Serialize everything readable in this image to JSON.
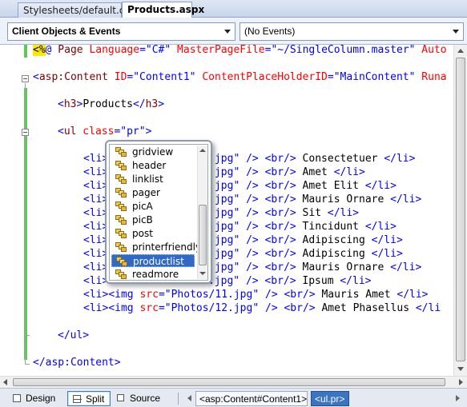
{
  "tabs": {
    "default_css": "Stylesheets/default.css",
    "products_aspx": "Products.aspx"
  },
  "dropdowns": {
    "objects": "Client Objects & Events",
    "events": "(No Events)"
  },
  "code": {
    "l1": {
      "a": "<%",
      "b": "@",
      "c": " Page ",
      "d": "Language",
      "e": "=",
      "f": "\"C#\"",
      "g": " MasterPageFile",
      "h": "=",
      "i": "\"~/SingleColumn.master\"",
      "j": " Auto"
    },
    "l3": {
      "a": "<",
      "b": "asp:Content",
      "c": " ID",
      "d": "=",
      "e": "\"Content1\"",
      "f": " ContentPlaceHolderID",
      "g": "=",
      "h": "\"MainContent\"",
      "i": " Runa"
    },
    "l5": {
      "a": "<",
      "b": "h3",
      "c": ">",
      "d": "Products",
      "e": "</",
      "f": "h3",
      "g": ">"
    },
    "l7": {
      "a": "<",
      "b": "ul",
      "c": " class",
      "d": "=",
      "e": "\"pr\"",
      "f": ">"
    },
    "items": [
      {
        "pre": "<li>",
        "src": "1.jpg\"",
        "text": " Consectetuer "
      },
      {
        "pre": "<li>",
        "src": "2.jpg\"",
        "text": " Amet "
      },
      {
        "pre": "<li>",
        "src": "3.jpg\"",
        "text": " Amet Elit "
      },
      {
        "pre": "<li>",
        "src": "4.jpg\"",
        "text": " Mauris Ornare "
      },
      {
        "pre": "<li>",
        "src": "5.jpg\"",
        "text": " Sit "
      },
      {
        "pre": "<li>",
        "src": "6.jpg\"",
        "text": " Tincidunt "
      },
      {
        "pre": "<li>",
        "src": "7.jpg\"",
        "text": " Adipiscing "
      },
      {
        "pre": "<li>",
        "src": "8.jpg\"",
        "text": " Adipiscing "
      },
      {
        "pre": "<li>",
        "src": "9.jpg\"",
        "text": " Mauris Ornare "
      },
      {
        "pre": "<li>",
        "src": "10.jpg\"",
        "text": " Ipsum "
      }
    ],
    "full_items": [
      {
        "li": "<li>",
        "img": "<img",
        "srcattr": " src",
        "eq": "=",
        "src": "\"Photos/11.jpg\"",
        "close": " /> ",
        "br": "<br/>",
        "text": " Mauris Amet ",
        "end": "</li>"
      },
      {
        "li": "<li>",
        "img": "<img",
        "srcattr": " src",
        "eq": "=",
        "src": "\"Photos/12.jpg\"",
        "close": " /> ",
        "br": "<br/>",
        "text": " Amet Phasellus ",
        "end": "</li"
      }
    ],
    "close_tag": "/>",
    "br_tag": "<br/>",
    "end_li": "</li>",
    "l_ul_end": "</ul>",
    "l_content_end": "</asp:Content>"
  },
  "intellisense": {
    "items": [
      "gridview",
      "header",
      "linklist",
      "pager",
      "picA",
      "picB",
      "post",
      "printerfriendly",
      "productlist",
      "readmore"
    ],
    "selected": "productlist",
    "icon": "css-class-icon"
  },
  "bottombar": {
    "design": "Design",
    "split": "Split",
    "source": "Source",
    "crumb1": "<asp:Content#Content1>",
    "crumb2": "<ul.pr>"
  },
  "colors": {
    "tag_blue": "#0000ff",
    "element_maroon": "#800000",
    "attribute_red": "#ff0000",
    "directive_yellow": "#ffe700",
    "change_green": "#62c55a",
    "selection_blue": "#3169c6"
  }
}
